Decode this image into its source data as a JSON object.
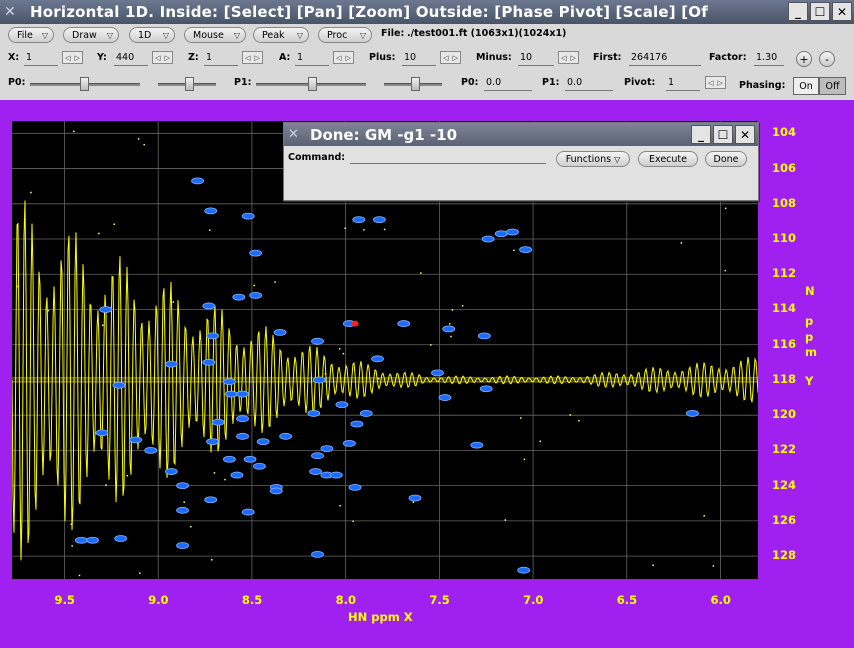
{
  "window": {
    "title": "Horizontal 1D.   Inside: [Select] [Pan] [Zoom]   Outside: [Phase Pivot] [Scale] [Of",
    "minimize_label": "_",
    "maximize_label": "☐",
    "close_label": "✕"
  },
  "menus": [
    {
      "label": "File"
    },
    {
      "label": "Draw"
    },
    {
      "label": "1D"
    },
    {
      "label": "Mouse"
    },
    {
      "label": "Peak"
    },
    {
      "label": "Proc"
    }
  ],
  "file_info": {
    "label": "File:",
    "value": "./test001.ft (1063x1)(1024x1)"
  },
  "fields_row2": [
    {
      "label": "X:",
      "value": "1"
    },
    {
      "label": "Y:",
      "value": "440"
    },
    {
      "label": "Z:",
      "value": "1"
    },
    {
      "label": "A:",
      "value": "1"
    },
    {
      "label": "Plus:",
      "value": "10"
    },
    {
      "label": "Minus:",
      "value": "10"
    },
    {
      "label": "First:",
      "value": "264176"
    },
    {
      "label": "Factor:",
      "value": "1.30"
    }
  ],
  "zoom_buttons": {
    "plus": "+",
    "minus": "-"
  },
  "phase_row": {
    "p0_label": "P0:",
    "p1_label": "P1:",
    "p0_value_label": "P0:",
    "p0_value": "0.0",
    "p1_value_label": "P1:",
    "p1_value": "0.0",
    "pivot_label": "Pivot:",
    "pivot_value": "1",
    "phasing_label": "Phasing:",
    "on_label": "On",
    "off_label": "Off",
    "phasing_state": "Off"
  },
  "dialog": {
    "title": "Done: GM -g1 -10",
    "command_label": "Command:",
    "command_value": "",
    "functions_label": "Functions",
    "execute_label": "Execute",
    "done_label": "Done"
  },
  "axes": {
    "x_ticks": [
      "9.5",
      "9.0",
      "8.5",
      "8.0",
      "7.5",
      "7.0",
      "6.5",
      "6.0"
    ],
    "y_ticks": [
      "104",
      "106",
      "108",
      "110",
      "112",
      "114",
      "116",
      "118",
      "120",
      "122",
      "124",
      "126",
      "128"
    ],
    "x_title": "HN ppm X",
    "y_title_letters": [
      "N",
      "p",
      "p",
      "m",
      "Y"
    ]
  },
  "colors": {
    "background": "#a020f0",
    "plot_bg": "#000000",
    "axis_text": "#ffff00",
    "trace": "#ffff00",
    "peaks": "#1e6bff",
    "grid": "#666666"
  },
  "chart_data": {
    "type": "scatter",
    "xlabel": "HN ppm X",
    "ylabel": "N ppm Y",
    "xlim": [
      9.78,
      5.8
    ],
    "ylim": [
      103.3,
      129.3
    ],
    "x_axis_reversed": true,
    "y_axis_reversed": true,
    "grid": true,
    "trace_baseline_ppm": 118.0,
    "peaks": [
      [
        8.79,
        106.7
      ],
      [
        8.72,
        108.4
      ],
      [
        8.52,
        108.7
      ],
      [
        8.48,
        110.8
      ],
      [
        7.93,
        108.9
      ],
      [
        7.82,
        108.9
      ],
      [
        7.24,
        110.0
      ],
      [
        7.17,
        109.7
      ],
      [
        7.11,
        109.6
      ],
      [
        7.04,
        110.6
      ],
      [
        8.57,
        113.3
      ],
      [
        8.48,
        113.2
      ],
      [
        8.73,
        113.8
      ],
      [
        9.28,
        114.0
      ],
      [
        7.98,
        114.8
      ],
      [
        7.69,
        114.8
      ],
      [
        7.45,
        115.1
      ],
      [
        7.26,
        115.5
      ],
      [
        8.71,
        115.5
      ],
      [
        8.35,
        115.3
      ],
      [
        8.15,
        115.8
      ],
      [
        8.93,
        117.1
      ],
      [
        8.73,
        117.0
      ],
      [
        7.83,
        116.8
      ],
      [
        7.51,
        117.6
      ],
      [
        8.14,
        118.0
      ],
      [
        9.21,
        118.3
      ],
      [
        8.62,
        118.1
      ],
      [
        8.61,
        118.8
      ],
      [
        8.55,
        118.8
      ],
      [
        7.47,
        119.0
      ],
      [
        7.25,
        118.5
      ],
      [
        8.02,
        119.4
      ],
      [
        7.89,
        119.9
      ],
      [
        8.17,
        119.9
      ],
      [
        8.68,
        120.4
      ],
      [
        8.55,
        120.2
      ],
      [
        7.94,
        120.5
      ],
      [
        9.3,
        121.0
      ],
      [
        9.12,
        121.4
      ],
      [
        8.71,
        121.5
      ],
      [
        8.55,
        121.2
      ],
      [
        8.44,
        121.5
      ],
      [
        8.32,
        121.2
      ],
      [
        8.1,
        121.9
      ],
      [
        7.98,
        121.6
      ],
      [
        7.3,
        121.7
      ],
      [
        9.04,
        122.0
      ],
      [
        8.62,
        122.5
      ],
      [
        8.51,
        122.5
      ],
      [
        8.15,
        122.3
      ],
      [
        8.46,
        122.9
      ],
      [
        8.16,
        123.2
      ],
      [
        8.1,
        123.4
      ],
      [
        8.05,
        123.4
      ],
      [
        8.58,
        123.4
      ],
      [
        8.93,
        123.2
      ],
      [
        8.87,
        124.0
      ],
      [
        8.37,
        124.1
      ],
      [
        8.37,
        124.3
      ],
      [
        7.95,
        124.1
      ],
      [
        7.63,
        124.7
      ],
      [
        8.72,
        124.8
      ],
      [
        8.87,
        125.4
      ],
      [
        8.52,
        125.5
      ],
      [
        9.41,
        127.1
      ],
      [
        9.35,
        127.1
      ],
      [
        9.2,
        127.0
      ],
      [
        8.87,
        127.4
      ],
      [
        8.15,
        127.9
      ],
      [
        7.05,
        128.8
      ],
      [
        6.15,
        119.9
      ]
    ]
  }
}
